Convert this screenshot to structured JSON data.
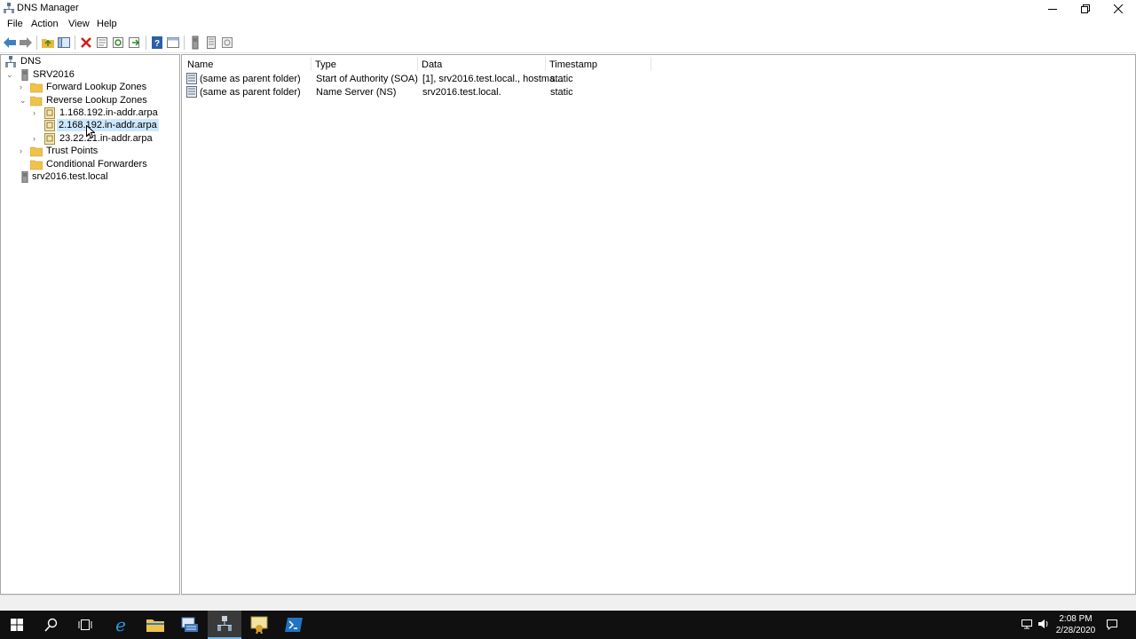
{
  "window": {
    "title": "DNS Manager"
  },
  "menu": [
    "File",
    "Action",
    "View",
    "Help"
  ],
  "tree": {
    "root": "DNS",
    "server": "SRV2016",
    "forward_zones": "Forward Lookup Zones",
    "reverse_zones": "Reverse Lookup Zones",
    "zones": [
      "1.168.192.in-addr.arpa",
      "2.168.192.in-addr.arpa",
      "23.22.21.in-addr.arpa"
    ],
    "trust_points": "Trust Points",
    "conditional_forwarders": "Conditional Forwarders",
    "global_logs": "srv2016.test.local"
  },
  "list": {
    "columns": [
      "Name",
      "Type",
      "Data",
      "Timestamp"
    ],
    "rows": [
      {
        "name": "(same as parent folder)",
        "type": "Start of Authority (SOA)",
        "data": "[1], srv2016.test.local., hostma...",
        "timestamp": "static"
      },
      {
        "name": "(same as parent folder)",
        "type": "Name Server (NS)",
        "data": "srv2016.test.local.",
        "timestamp": "static"
      }
    ]
  },
  "taskbar": {
    "time": "2:08 PM",
    "date": "2/28/2020"
  },
  "colors": {
    "selection": "#cce8ff",
    "folder": "#f0c24a",
    "taskbar": "#101010",
    "delete": "#d0201a"
  }
}
